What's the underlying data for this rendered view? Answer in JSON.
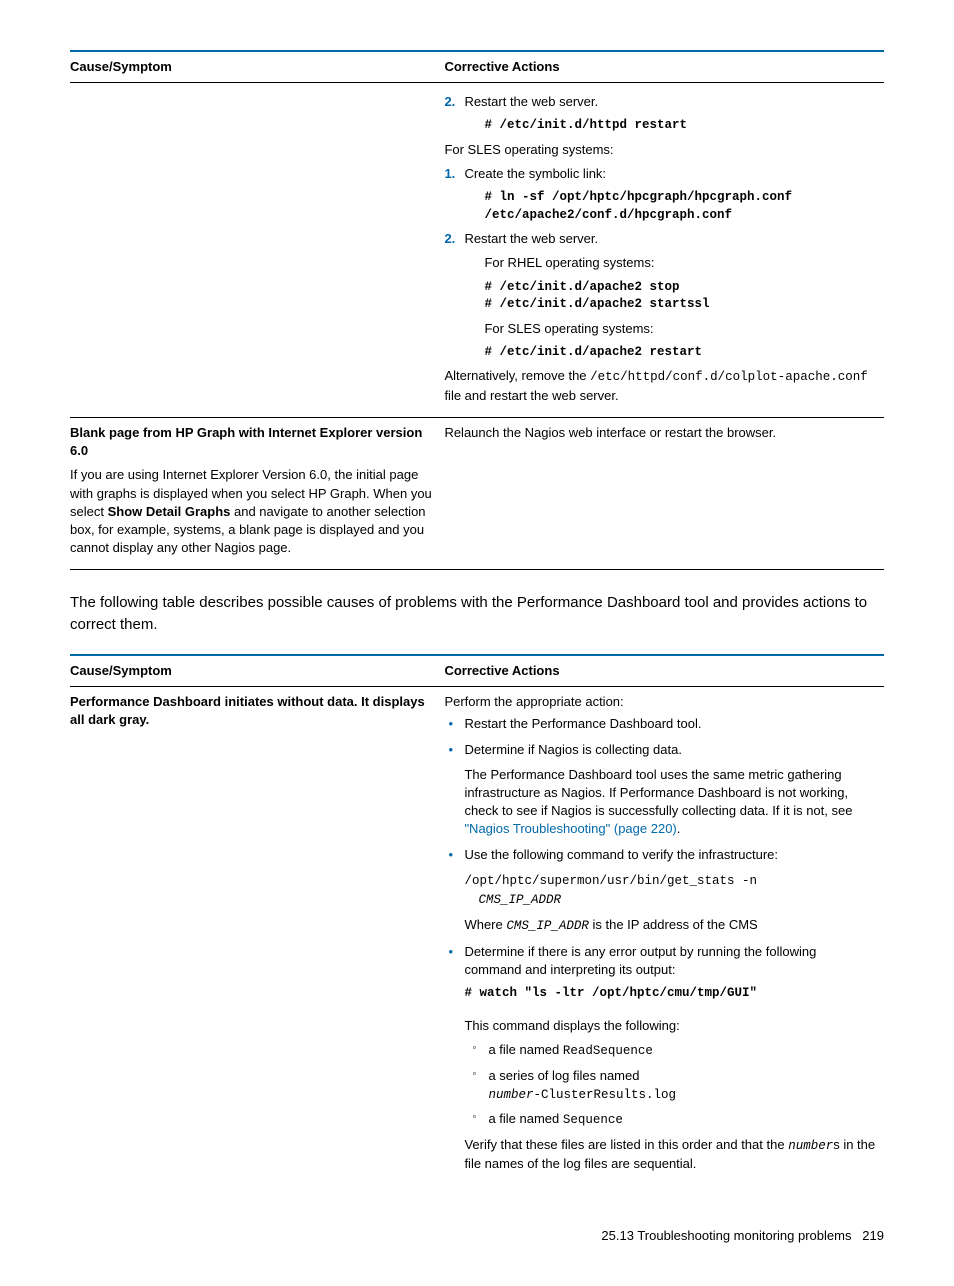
{
  "table1": {
    "headers": {
      "left": "Cause/Symptom",
      "right": "Corrective Actions"
    },
    "row1": {
      "right": {
        "step2_label": "2.",
        "step2_text": "Restart the web server.",
        "step2_cmd": "# /etc/init.d/httpd restart",
        "sles_intro": "For SLES operating systems:",
        "sles1_label": "1.",
        "sles1_text": "Create the symbolic link:",
        "sles1_cmd_a": "# ln -sf /opt/hptc/hpcgraph/hpcgraph.conf",
        "sles1_cmd_b": "/etc/apache2/conf.d/hpcgraph.conf",
        "sles2_label": "2.",
        "sles2_text": "Restart the web server.",
        "rhel_for": "For RHEL operating systems:",
        "rhel_cmd_a": "# /etc/init.d/apache2 stop",
        "rhel_cmd_b": "# /etc/init.d/apache2 startssl",
        "sles_for": "For SLES operating systems:",
        "sles_cmd": "# /etc/init.d/apache2 restart",
        "alt_a": "Alternatively, remove the ",
        "alt_code": "/etc/httpd/conf.d/colplot-apache.conf",
        "alt_b": " file and restart the web server."
      }
    },
    "row2": {
      "left_title": "Blank page from HP Graph with Internet Explorer version 6.0",
      "left_body_a": "If you are using Internet Explorer Version 6.0, the initial page with graphs is displayed when you select HP Graph. When you select ",
      "left_body_bold": "Show Detail Graphs",
      "left_body_b": " and navigate to another selection box, for example, systems, a blank page is displayed and you cannot display any other Nagios page.",
      "right": "Relaunch the Nagios web interface or restart the browser."
    }
  },
  "intro_para": "The following table describes possible causes of problems with the Performance Dashboard tool and provides actions to correct them.",
  "table2": {
    "headers": {
      "left": "Cause/Symptom",
      "right": "Corrective Actions"
    },
    "row1": {
      "left": "Performance Dashboard initiates without data. It displays all dark gray.",
      "right": {
        "intro": "Perform the appropriate action:",
        "b1": "Restart the Performance Dashboard tool.",
        "b2": "Determine if Nagios is collecting data.",
        "b2_para_a": "The Performance Dashboard tool uses the same metric gathering infrastructure as Nagios. If Performance Dashboard is not working, check to see if Nagios is successfully collecting data. If it is not, see ",
        "b2_link": "\"Nagios Troubleshooting\" (page 220)",
        "b2_para_b": ".",
        "b3": "Use the following command to verify the infrastructure:",
        "b3_cmd_a": "/opt/hptc/supermon/usr/bin/get_stats -n",
        "b3_cmd_b": "CMS_IP_ADDR",
        "b3_where_a": "Where ",
        "b3_where_code": "CMS_IP_ADDR",
        "b3_where_b": " is the IP address of the CMS",
        "b4": "Determine if there is any error output by running the following command and interpreting its output:",
        "b4_cmd": "# watch \"ls -ltr /opt/hptc/cmu/tmp/GUI\"",
        "b4_after": "This command displays the following:",
        "c1_a": "a file named ",
        "c1_code": "ReadSequence",
        "c2_a": "a series of log files named ",
        "c2_code_a": "number",
        "c2_code_b": "-ClusterResults.log",
        "c3_a": "a file named ",
        "c3_code": "Sequence",
        "verify_a": "Verify that these files are listed in this order and that the ",
        "verify_code": "number",
        "verify_b": "s in the file names of the log files are sequential."
      }
    }
  },
  "footer": {
    "section": "25.13 Troubleshooting monitoring problems",
    "page": "219"
  }
}
